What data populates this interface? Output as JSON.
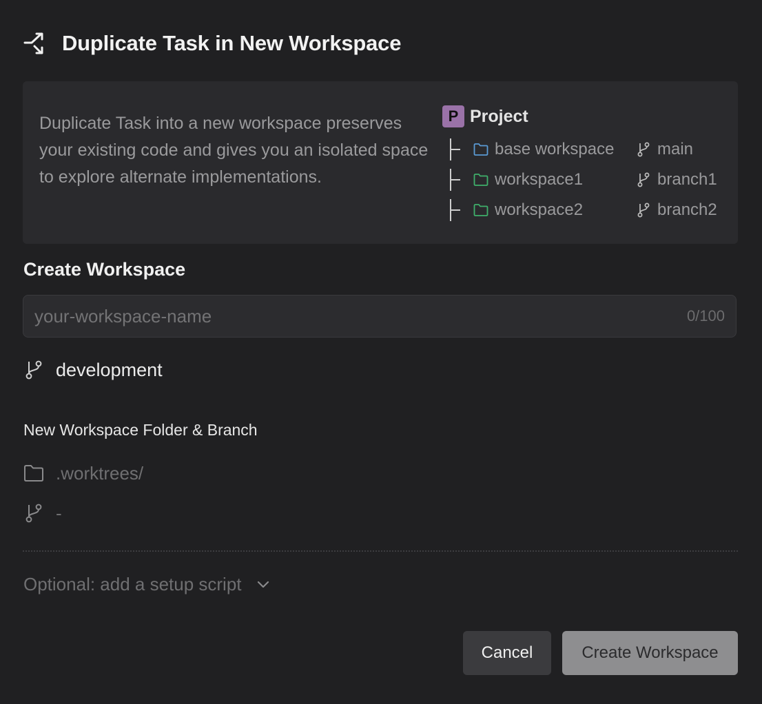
{
  "dialog": {
    "title": "Duplicate Task in New Workspace",
    "title_icon": "fork-arrows-icon"
  },
  "info": {
    "description": "Duplicate Task into a new workspace preserves your existing code and gives you an isolated space to explore alternate implementations.",
    "project": {
      "badge": "P",
      "label": "Project",
      "badge_color": "#9a72a8"
    },
    "tree": [
      {
        "name": "base workspace",
        "branch": "main",
        "folder_color": "#5b9bd5"
      },
      {
        "name": "workspace1",
        "branch": "branch1",
        "folder_color": "#3fb06b"
      },
      {
        "name": "workspace2",
        "branch": "branch2",
        "folder_color": "#3fb06b"
      }
    ]
  },
  "create": {
    "section_title": "Create Workspace",
    "name_input": {
      "placeholder": "your-workspace-name",
      "value": "",
      "counter": "0/100"
    },
    "base_branch": "development",
    "folder_branch_label": "New Workspace Folder & Branch",
    "folder_path": ".worktrees/",
    "new_branch": "-"
  },
  "setup": {
    "label": "Optional: add a setup script"
  },
  "buttons": {
    "cancel": "Cancel",
    "create": "Create Workspace"
  }
}
